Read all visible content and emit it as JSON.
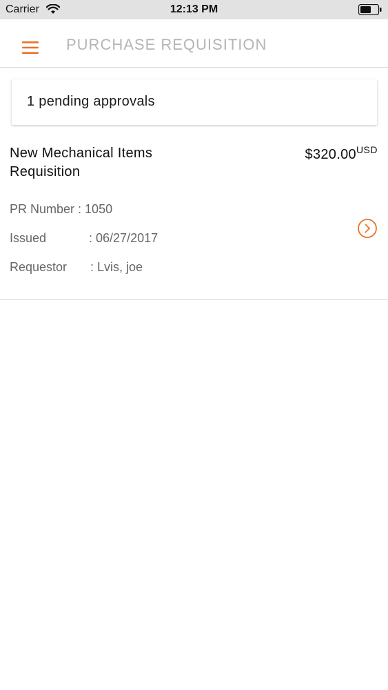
{
  "status_bar": {
    "carrier": "Carrier",
    "time": "12:13 PM"
  },
  "header": {
    "title": "PURCHASE REQUISITION"
  },
  "pending": {
    "text": "1 pending approvals"
  },
  "requisition": {
    "title": "New Mechanical Items Requisition",
    "amount": "$320.00",
    "currency": "USD",
    "pr_number_label": "PR Number",
    "pr_number_value": ": 1050",
    "issued_label": "Issued",
    "issued_value": ": 06/27/2017",
    "requestor_label": "Requestor",
    "requestor_value": ": Lvis, joe"
  },
  "colors": {
    "accent": "#e8742a",
    "title_gray": "#b5b5b5",
    "status_bar": "#e2e2e2"
  }
}
